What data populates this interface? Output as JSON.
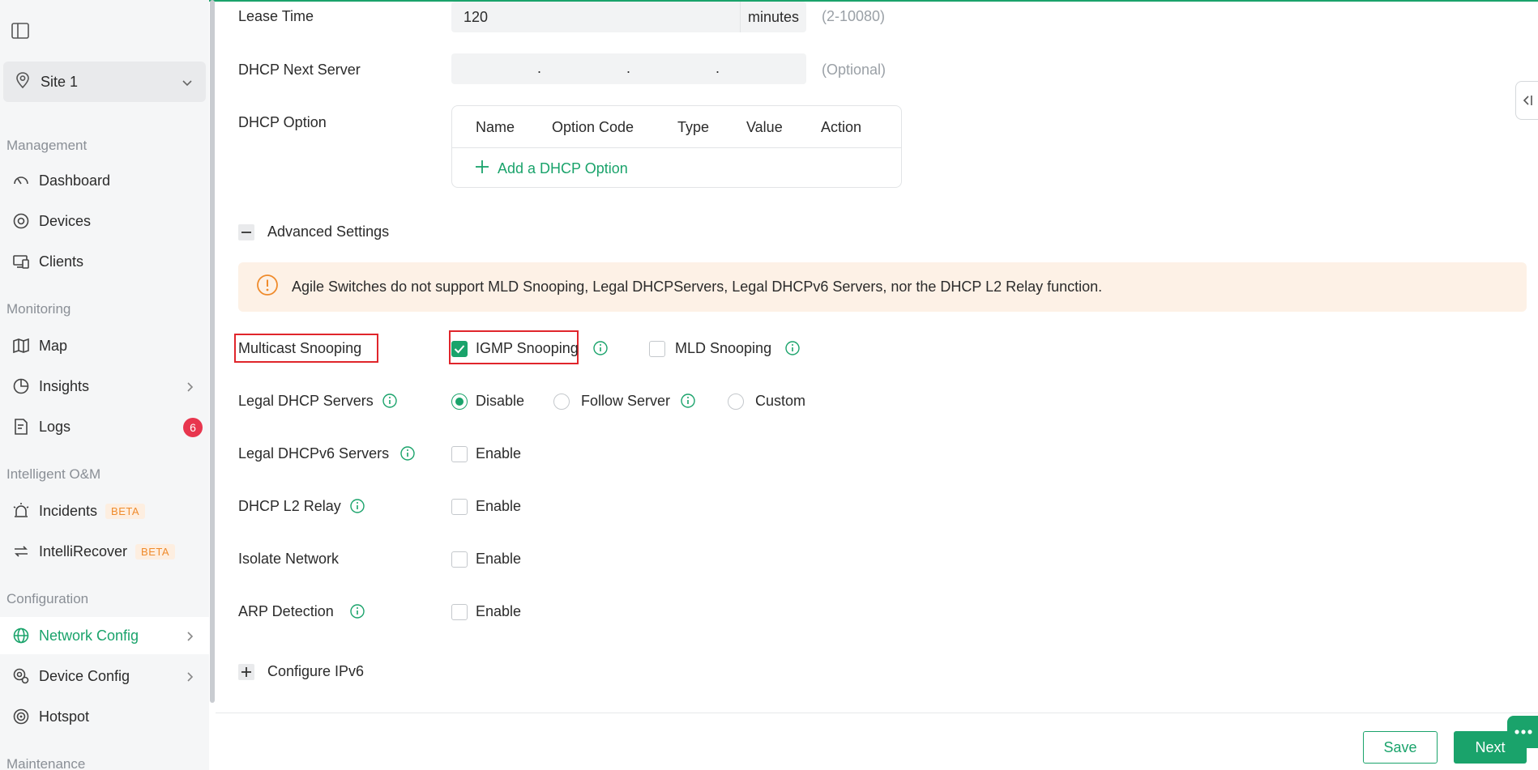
{
  "sidebar": {
    "site": "Site 1",
    "sections": {
      "management": "Management",
      "monitoring": "Monitoring",
      "intelligent": "Intelligent O&M",
      "configuration": "Configuration",
      "maintenance": "Maintenance"
    },
    "items": {
      "dashboard": "Dashboard",
      "devices": "Devices",
      "clients": "Clients",
      "map": "Map",
      "insights": "Insights",
      "logs": "Logs",
      "logs_badge": "6",
      "incidents": "Incidents",
      "intellirecover": "IntelliRecover",
      "beta": "BETA",
      "network_config": "Network Config",
      "device_config": "Device Config",
      "hotspot": "Hotspot"
    }
  },
  "form": {
    "lease_time": {
      "label": "Lease Time",
      "value": "120",
      "unit": "minutes",
      "hint": "(2-10080)"
    },
    "next_server": {
      "label": "DHCP Next Server",
      "hint": "(Optional)",
      "dot": "."
    },
    "dhcp_option": {
      "label": "DHCP Option",
      "columns": [
        "Name",
        "Option Code",
        "Type",
        "Value",
        "Action"
      ],
      "add_label": "Add a DHCP Option"
    },
    "advanced": "Advanced Settings",
    "notice": "Agile Switches do not support MLD Snooping, Legal DHCPServers, Legal DHCPv6 Servers, nor the DHCP L2 Relay function.",
    "multicast": {
      "label": "Multicast Snooping",
      "igmp": "IGMP Snooping",
      "mld": "MLD Snooping"
    },
    "legal_dhcp": {
      "label": "Legal DHCP Servers",
      "disable": "Disable",
      "follow": "Follow Server",
      "custom": "Custom"
    },
    "legal_dhcpv6": {
      "label": "Legal DHCPv6 Servers",
      "enable": "Enable"
    },
    "l2_relay": {
      "label": "DHCP L2 Relay",
      "enable": "Enable"
    },
    "isolate": {
      "label": "Isolate Network",
      "enable": "Enable"
    },
    "arp": {
      "label": "ARP Detection",
      "enable": "Enable"
    },
    "ipv6": "Configure IPv6"
  },
  "footer": {
    "save": "Save",
    "next": "Next"
  },
  "colors": {
    "accent": "#1aa36b",
    "badge": "#e8364e",
    "beta": "#ef8b2c",
    "notice_bg": "#fdf1e6",
    "highlight": "#e0252b"
  }
}
